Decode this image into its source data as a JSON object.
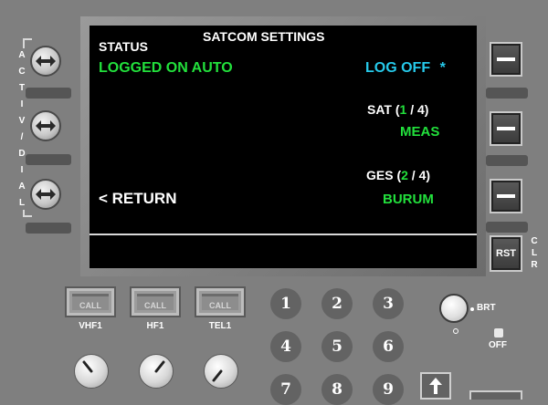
{
  "screen": {
    "title": "SATCOM SETTINGS",
    "status_label": "STATUS",
    "status_value": "LOGGED ON AUTO",
    "log_off": "LOG OFF",
    "log_off_marker": "*",
    "sat_label": "SAT (",
    "sat_current": "1",
    "sat_sep": " / ",
    "sat_total": "4",
    "sat_close": ")",
    "sat_value": "MEAS",
    "ges_label": "GES (",
    "ges_current": "2",
    "ges_sep": " / ",
    "ges_total": "4",
    "ges_close": ")",
    "ges_value": "BURUM",
    "return_label": "< RETURN"
  },
  "left_panel": {
    "vertical_label": [
      "A",
      "C",
      "T",
      "I",
      "V",
      "/",
      "D",
      "I",
      "A",
      "L"
    ]
  },
  "right_panel": {
    "rst_label": "RST",
    "clr_label": [
      "C",
      "L",
      "R"
    ]
  },
  "radio": {
    "buttons": [
      {
        "call": "CALL",
        "label": "VHF1"
      },
      {
        "call": "CALL",
        "label": "HF1"
      },
      {
        "call": "CALL",
        "label": "TEL1"
      }
    ]
  },
  "keypad": {
    "keys": [
      "1",
      "2",
      "3",
      "4",
      "5",
      "6",
      "7",
      "8",
      "9"
    ]
  },
  "brightness": {
    "brt_label": "BRT",
    "off_label": "OFF"
  },
  "colors": {
    "screen_bg": "#000000",
    "green": "#22e03c",
    "cyan": "#26c9ea",
    "white": "#ffffff",
    "panel": "#7f7f7f"
  }
}
